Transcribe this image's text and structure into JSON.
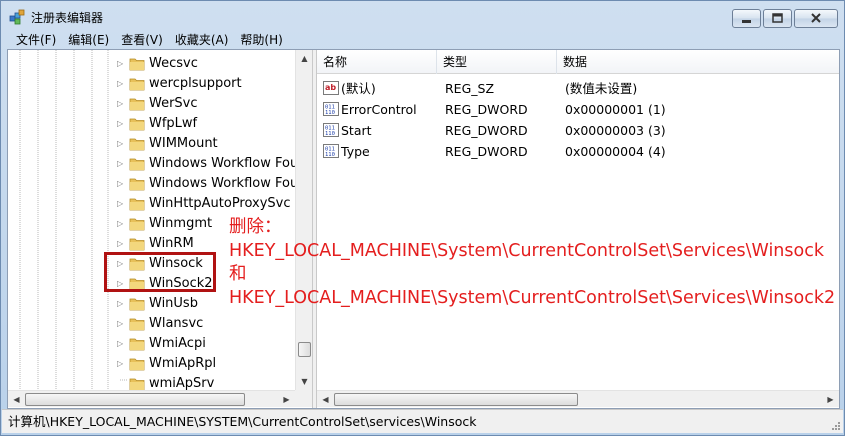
{
  "window": {
    "title": "注册表编辑器",
    "app_icon": "regedit-icon",
    "buttons": {
      "minimize_icon": "minimize-icon",
      "maximize_icon": "maximize-icon",
      "close_icon": "close-icon"
    }
  },
  "menu": [
    {
      "label": "文件(F)"
    },
    {
      "label": "编辑(E)"
    },
    {
      "label": "查看(V)"
    },
    {
      "label": "收藏夹(A)"
    },
    {
      "label": "帮助(H)"
    }
  ],
  "tree": {
    "items": [
      {
        "label": "Wecsvc"
      },
      {
        "label": "wercplsupport"
      },
      {
        "label": "WerSvc"
      },
      {
        "label": "WfpLwf"
      },
      {
        "label": "WIMMount"
      },
      {
        "label": "Windows Workflow Foun"
      },
      {
        "label": "Windows Workflow Foun"
      },
      {
        "label": "WinHttpAutoProxySvc"
      },
      {
        "label": "Winmgmt"
      },
      {
        "label": "WinRM"
      },
      {
        "label": "Winsock"
      },
      {
        "label": "WinSock2"
      },
      {
        "label": "WinUsb"
      },
      {
        "label": "Wlansvc"
      },
      {
        "label": "WmiAcpi"
      },
      {
        "label": "WmiApRpl"
      },
      {
        "label": "wmiApSrv"
      }
    ],
    "expander_glyph": "▷",
    "folder_color": "#e8c15a"
  },
  "list": {
    "columns": {
      "name": "名称",
      "type": "类型",
      "data": "数据"
    },
    "rows": [
      {
        "icon": "string-value-icon",
        "name": "(默认)",
        "type": "REG_SZ",
        "data": "(数值未设置)"
      },
      {
        "icon": "dword-value-icon",
        "name": "ErrorControl",
        "type": "REG_DWORD",
        "data": "0x00000001 (1)"
      },
      {
        "icon": "dword-value-icon",
        "name": "Start",
        "type": "REG_DWORD",
        "data": "0x00000003 (3)"
      },
      {
        "icon": "dword-value-icon",
        "name": "Type",
        "type": "REG_DWORD",
        "data": "0x00000004 (4)"
      }
    ]
  },
  "statusbar": {
    "path": "计算机\\HKEY_LOCAL_MACHINE\\SYSTEM\\CurrentControlSet\\services\\Winsock"
  },
  "annotation": {
    "color": "#e41e1e",
    "line1": "删除：",
    "line2": "HKEY_LOCAL_MACHINE\\System\\CurrentControlSet\\Services\\Winsock",
    "line3": "和",
    "line4": "HKEY_LOCAL_MACHINE\\System\\CurrentControlSet\\Services\\Winsock2",
    "box_color": "#b01212"
  }
}
